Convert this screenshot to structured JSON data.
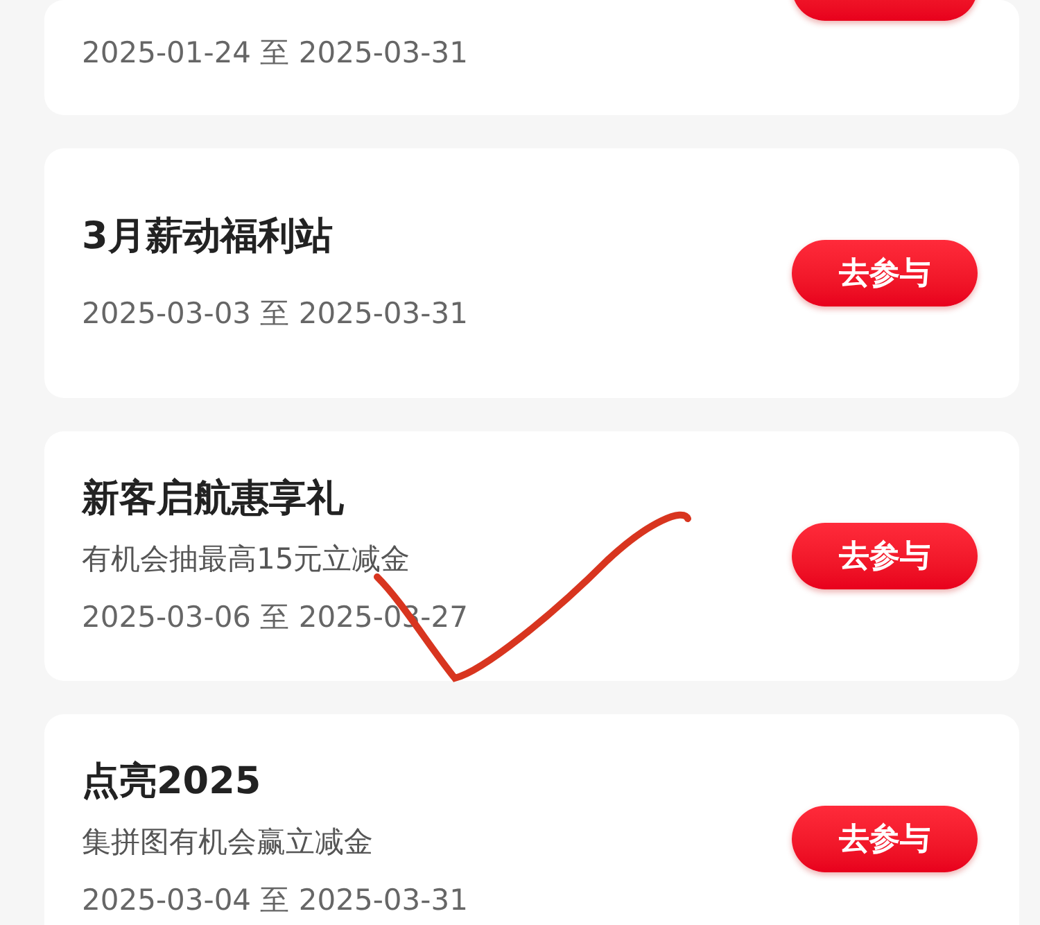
{
  "activities": [
    {
      "date_range": "2025-01-24 至 2025-03-31",
      "button": {
        "cut": true
      }
    },
    {
      "title": "3月薪动福利站",
      "date_range": "2025-03-03 至 2025-03-31",
      "button": {
        "label": "去参与"
      }
    },
    {
      "title": "新客启航惠享礼",
      "description": "有机会抽最高15元立减金",
      "date_range": "2025-03-06 至 2025-03-27",
      "button": {
        "label": "去参与"
      }
    },
    {
      "title": "点亮2025",
      "description": "集拼图有机会赢立减金",
      "date_range": "2025-03-04 至 2025-03-31",
      "button": {
        "label": "去参与"
      }
    }
  ]
}
